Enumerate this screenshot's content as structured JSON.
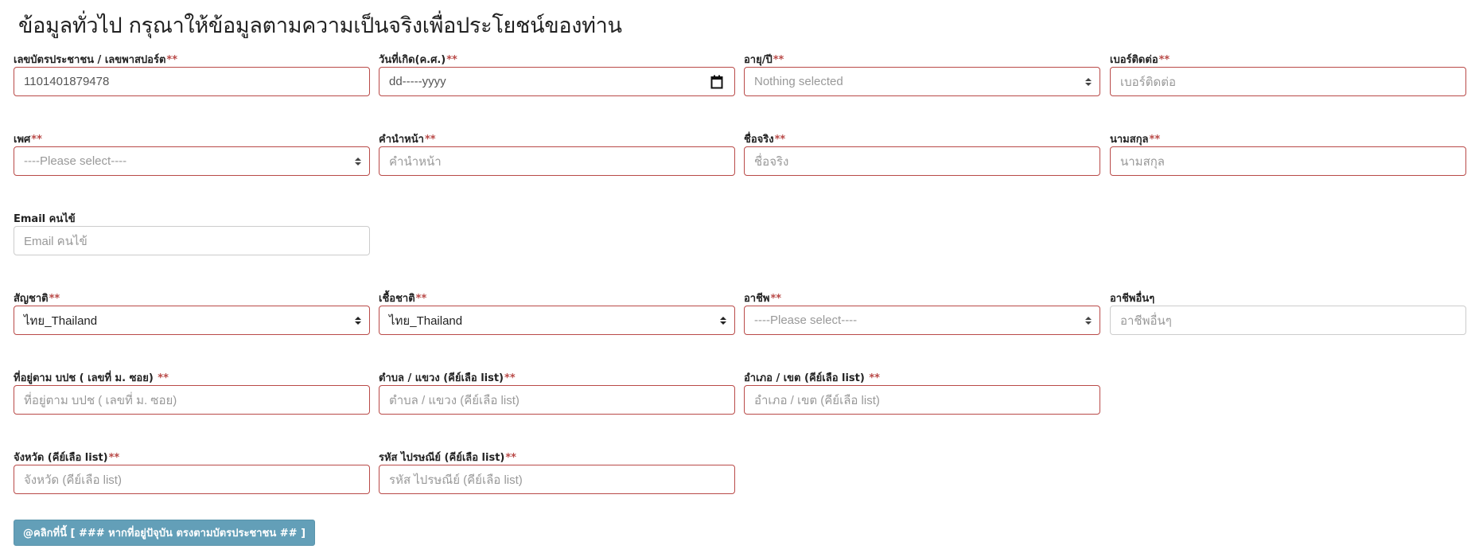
{
  "title": "ข้อมูลทั่วไป กรุณาให้ข้อมูลตามความเป็นจริงเพื่อประโยชน์ของท่าน",
  "required_mark": "**",
  "fields": {
    "id_card": {
      "label": "เลขบัตรประชาชน / เลขพาสปอร์ต",
      "value": "1101401879478"
    },
    "birthdate": {
      "label": "วันที่เกิด(ค.ศ.)",
      "value": "dd-----yyyy",
      "icon": "calendar-icon"
    },
    "age": {
      "label": "อายุ/ปี",
      "placeholder": "Nothing selected"
    },
    "phone": {
      "label": "เบอร์ติดต่อ",
      "placeholder": "เบอร์ติดต่อ"
    },
    "gender": {
      "label": "เพศ",
      "placeholder": "----Please select----"
    },
    "prefix": {
      "label": "คำนำหน้า",
      "placeholder": "คำนำหน้า"
    },
    "first_name": {
      "label": "ชื่อจริง",
      "placeholder": "ชื่อจริง"
    },
    "last_name": {
      "label": "นามสกุล",
      "placeholder": "นามสกุล"
    },
    "email": {
      "label": "Email คนไข้",
      "placeholder": "Email คนไข้"
    },
    "nationality": {
      "label": "สัญชาติ",
      "value": "ไทย_Thailand"
    },
    "race": {
      "label": "เชื้อชาติ",
      "value": "ไทย_Thailand"
    },
    "occupation": {
      "label": "อาชีพ",
      "placeholder": "----Please select----"
    },
    "other_occupation": {
      "label": "อาชีพอื่นๆ",
      "placeholder": "อาชีพอื่นๆ"
    },
    "address": {
      "label": "ที่อยู่ตาม บปช ( เลขที่ ม. ซอย) ",
      "placeholder": "ที่อยู่ตาม บปช ( เลขที่ ม. ซอย)"
    },
    "subdistrict": {
      "label": "ตำบล / แขวง (คีย์เลือ list)",
      "placeholder": "ตำบล / แขวง  (คีย์เลือ list)"
    },
    "district": {
      "label": "อำเภอ / เขต (คีย์เลือ list) ",
      "placeholder": "อำเภอ / เขต (คีย์เลือ list)"
    },
    "province": {
      "label": "จังหวัด (คีย์เลือ list)",
      "placeholder": "จังหวัด (คีย์เลือ list)"
    },
    "postcode": {
      "label": "รหัส ไปรษณีย์ (คีย์เลือ list)",
      "placeholder": "รหัส ไปรษณีย์ (คีย์เลือ list)"
    }
  },
  "copy_address_button": "@คลิกที่นี้ [ ### หากที่อยู่ปัจุบัน ตรงตามบัตรประชาชน ## ]",
  "colors": {
    "required": "#b94a48",
    "error_border": "#b94a48",
    "button": "#639fb8"
  }
}
